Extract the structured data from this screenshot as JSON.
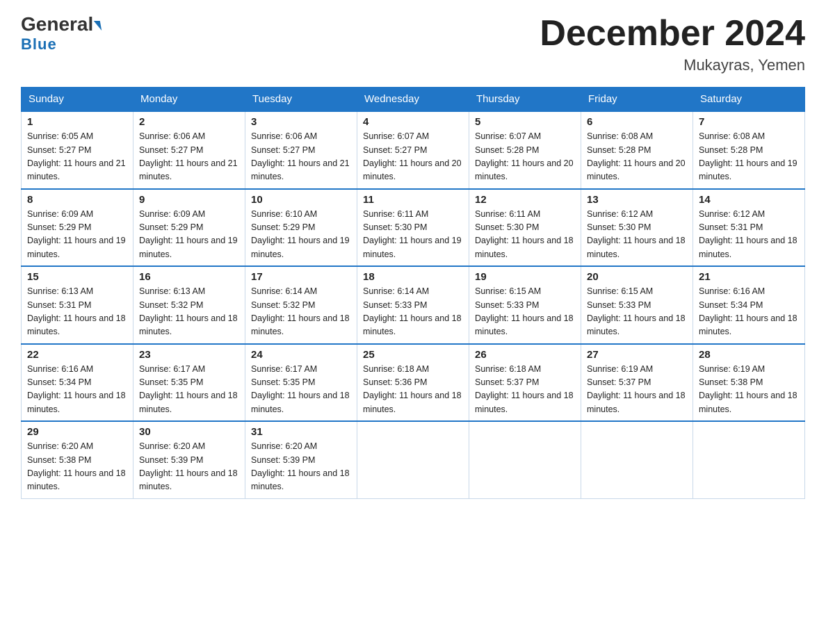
{
  "header": {
    "logo_general": "General",
    "logo_blue": "Blue",
    "month_title": "December 2024",
    "subtitle": "Mukayras, Yemen"
  },
  "days_of_week": [
    "Sunday",
    "Monday",
    "Tuesday",
    "Wednesday",
    "Thursday",
    "Friday",
    "Saturday"
  ],
  "weeks": [
    [
      {
        "day": "1",
        "sunrise": "6:05 AM",
        "sunset": "5:27 PM",
        "daylight": "11 hours and 21 minutes."
      },
      {
        "day": "2",
        "sunrise": "6:06 AM",
        "sunset": "5:27 PM",
        "daylight": "11 hours and 21 minutes."
      },
      {
        "day": "3",
        "sunrise": "6:06 AM",
        "sunset": "5:27 PM",
        "daylight": "11 hours and 21 minutes."
      },
      {
        "day": "4",
        "sunrise": "6:07 AM",
        "sunset": "5:27 PM",
        "daylight": "11 hours and 20 minutes."
      },
      {
        "day": "5",
        "sunrise": "6:07 AM",
        "sunset": "5:28 PM",
        "daylight": "11 hours and 20 minutes."
      },
      {
        "day": "6",
        "sunrise": "6:08 AM",
        "sunset": "5:28 PM",
        "daylight": "11 hours and 20 minutes."
      },
      {
        "day": "7",
        "sunrise": "6:08 AM",
        "sunset": "5:28 PM",
        "daylight": "11 hours and 19 minutes."
      }
    ],
    [
      {
        "day": "8",
        "sunrise": "6:09 AM",
        "sunset": "5:29 PM",
        "daylight": "11 hours and 19 minutes."
      },
      {
        "day": "9",
        "sunrise": "6:09 AM",
        "sunset": "5:29 PM",
        "daylight": "11 hours and 19 minutes."
      },
      {
        "day": "10",
        "sunrise": "6:10 AM",
        "sunset": "5:29 PM",
        "daylight": "11 hours and 19 minutes."
      },
      {
        "day": "11",
        "sunrise": "6:11 AM",
        "sunset": "5:30 PM",
        "daylight": "11 hours and 19 minutes."
      },
      {
        "day": "12",
        "sunrise": "6:11 AM",
        "sunset": "5:30 PM",
        "daylight": "11 hours and 18 minutes."
      },
      {
        "day": "13",
        "sunrise": "6:12 AM",
        "sunset": "5:30 PM",
        "daylight": "11 hours and 18 minutes."
      },
      {
        "day": "14",
        "sunrise": "6:12 AM",
        "sunset": "5:31 PM",
        "daylight": "11 hours and 18 minutes."
      }
    ],
    [
      {
        "day": "15",
        "sunrise": "6:13 AM",
        "sunset": "5:31 PM",
        "daylight": "11 hours and 18 minutes."
      },
      {
        "day": "16",
        "sunrise": "6:13 AM",
        "sunset": "5:32 PM",
        "daylight": "11 hours and 18 minutes."
      },
      {
        "day": "17",
        "sunrise": "6:14 AM",
        "sunset": "5:32 PM",
        "daylight": "11 hours and 18 minutes."
      },
      {
        "day": "18",
        "sunrise": "6:14 AM",
        "sunset": "5:33 PM",
        "daylight": "11 hours and 18 minutes."
      },
      {
        "day": "19",
        "sunrise": "6:15 AM",
        "sunset": "5:33 PM",
        "daylight": "11 hours and 18 minutes."
      },
      {
        "day": "20",
        "sunrise": "6:15 AM",
        "sunset": "5:33 PM",
        "daylight": "11 hours and 18 minutes."
      },
      {
        "day": "21",
        "sunrise": "6:16 AM",
        "sunset": "5:34 PM",
        "daylight": "11 hours and 18 minutes."
      }
    ],
    [
      {
        "day": "22",
        "sunrise": "6:16 AM",
        "sunset": "5:34 PM",
        "daylight": "11 hours and 18 minutes."
      },
      {
        "day": "23",
        "sunrise": "6:17 AM",
        "sunset": "5:35 PM",
        "daylight": "11 hours and 18 minutes."
      },
      {
        "day": "24",
        "sunrise": "6:17 AM",
        "sunset": "5:35 PM",
        "daylight": "11 hours and 18 minutes."
      },
      {
        "day": "25",
        "sunrise": "6:18 AM",
        "sunset": "5:36 PM",
        "daylight": "11 hours and 18 minutes."
      },
      {
        "day": "26",
        "sunrise": "6:18 AM",
        "sunset": "5:37 PM",
        "daylight": "11 hours and 18 minutes."
      },
      {
        "day": "27",
        "sunrise": "6:19 AM",
        "sunset": "5:37 PM",
        "daylight": "11 hours and 18 minutes."
      },
      {
        "day": "28",
        "sunrise": "6:19 AM",
        "sunset": "5:38 PM",
        "daylight": "11 hours and 18 minutes."
      }
    ],
    [
      {
        "day": "29",
        "sunrise": "6:20 AM",
        "sunset": "5:38 PM",
        "daylight": "11 hours and 18 minutes."
      },
      {
        "day": "30",
        "sunrise": "6:20 AM",
        "sunset": "5:39 PM",
        "daylight": "11 hours and 18 minutes."
      },
      {
        "day": "31",
        "sunrise": "6:20 AM",
        "sunset": "5:39 PM",
        "daylight": "11 hours and 18 minutes."
      },
      null,
      null,
      null,
      null
    ]
  ]
}
